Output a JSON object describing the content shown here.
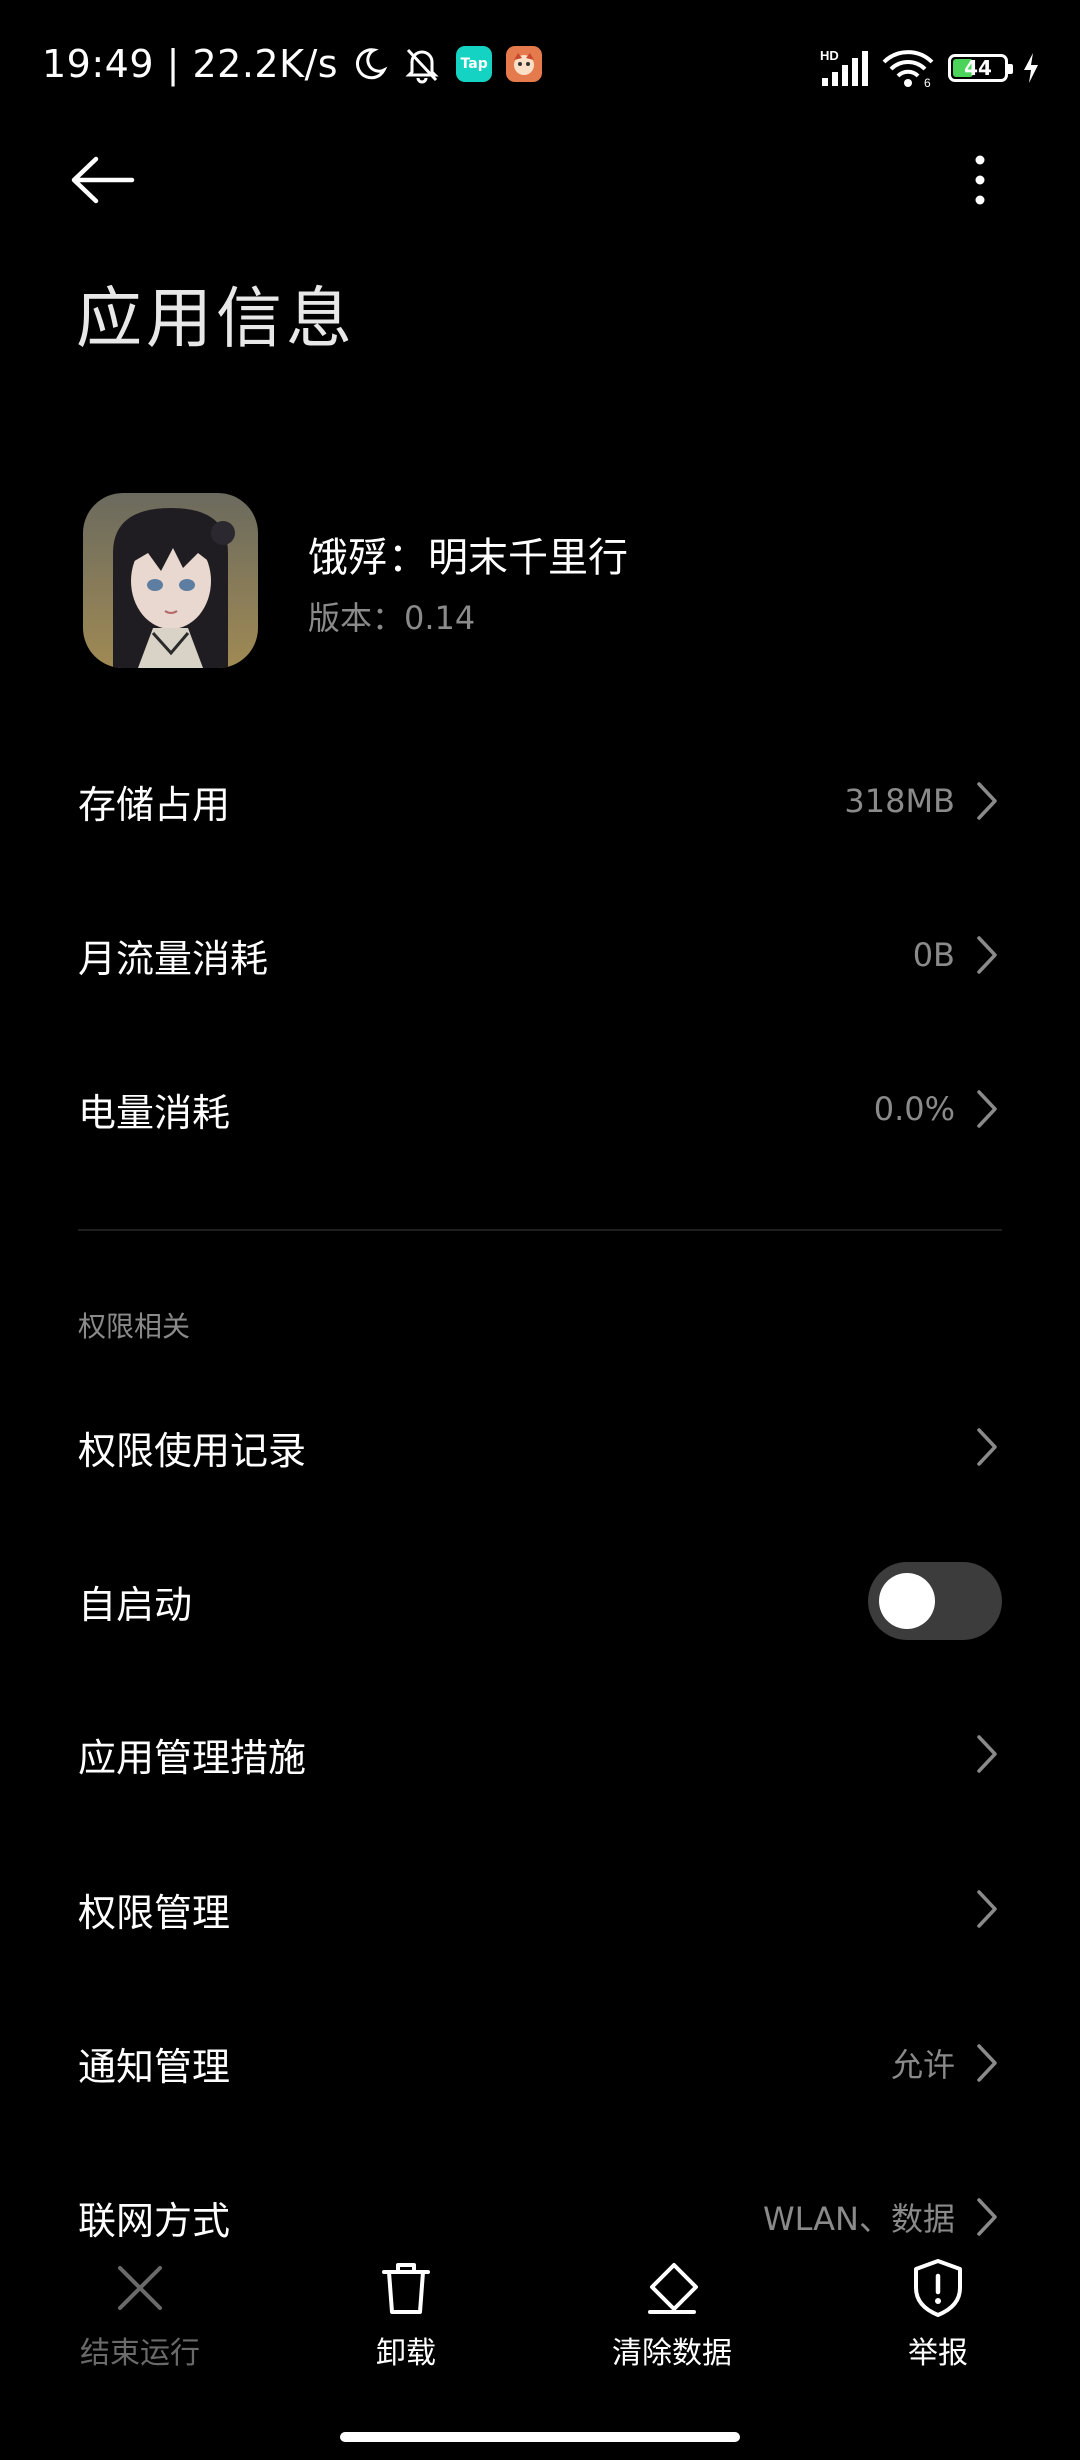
{
  "status_bar": {
    "time_speed": "19:49 | 22.2K/s",
    "tap_badge": "Tap",
    "hd_label": "HD",
    "wifi_label": "6",
    "battery_level": "44",
    "battery_fraction": 0.44,
    "battery_color": "#4cd35a",
    "icons": [
      "moon-icon",
      "bell-off-icon",
      "taptap-icon",
      "app-notification-icon",
      "signal-icon",
      "wifi-icon",
      "battery-icon",
      "charging-icon"
    ]
  },
  "header": {
    "title": "应用信息"
  },
  "app": {
    "name": "饿殍：明末千里行",
    "version": "版本：0.14"
  },
  "usage_rows": [
    {
      "label": "存储占用",
      "value": "318MB"
    },
    {
      "label": "月流量消耗",
      "value": "0B"
    },
    {
      "label": "电量消耗",
      "value": "0.0%"
    }
  ],
  "permissions": {
    "section_label": "权限相关",
    "rows": [
      {
        "label": "权限使用记录",
        "value": ""
      },
      {
        "label": "自启动",
        "toggle": false
      },
      {
        "label": "应用管理措施",
        "value": ""
      },
      {
        "label": "权限管理",
        "value": ""
      },
      {
        "label": "通知管理",
        "value": "允许"
      },
      {
        "label": "联网方式",
        "value": "WLAN、数据"
      }
    ]
  },
  "bottom_actions": [
    {
      "label": "结束运行",
      "icon": "close-icon",
      "enabled": false
    },
    {
      "label": "卸载",
      "icon": "trash-icon",
      "enabled": true
    },
    {
      "label": "清除数据",
      "icon": "eraser-icon",
      "enabled": true
    },
    {
      "label": "举报",
      "icon": "shield-alert-icon",
      "enabled": true
    }
  ]
}
